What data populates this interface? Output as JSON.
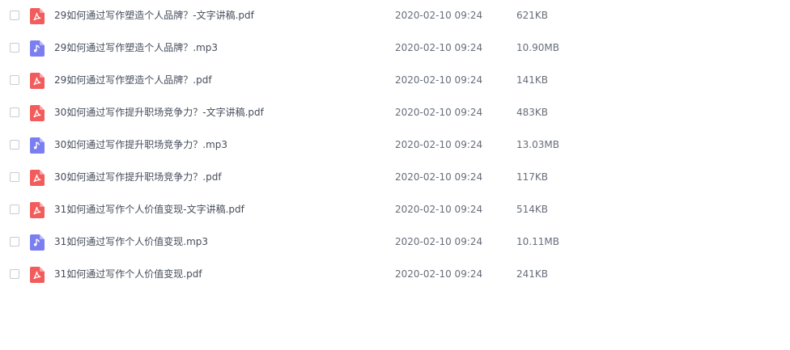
{
  "colors": {
    "pdf_icon": "#f25c5c",
    "mp3_icon": "#7b7ef0"
  },
  "files": [
    {
      "name": "29如何通过写作塑造个人品牌？-文字讲稿.pdf",
      "date": "2020-02-10 09:24",
      "size": "621KB",
      "type": "pdf",
      "icon": "pdf-icon"
    },
    {
      "name": "29如何通过写作塑造个人品牌？.mp3",
      "date": "2020-02-10 09:24",
      "size": "10.90MB",
      "type": "mp3",
      "icon": "music-note-icon"
    },
    {
      "name": "29如何通过写作塑造个人品牌？.pdf",
      "date": "2020-02-10 09:24",
      "size": "141KB",
      "type": "pdf",
      "icon": "pdf-icon"
    },
    {
      "name": "30如何通过写作提升职场竞争力？-文字讲稿.pdf",
      "date": "2020-02-10 09:24",
      "size": "483KB",
      "type": "pdf",
      "icon": "pdf-icon"
    },
    {
      "name": "30如何通过写作提升职场竞争力？.mp3",
      "date": "2020-02-10 09:24",
      "size": "13.03MB",
      "type": "mp3",
      "icon": "music-note-icon"
    },
    {
      "name": "30如何通过写作提升职场竞争力？.pdf",
      "date": "2020-02-10 09:24",
      "size": "117KB",
      "type": "pdf",
      "icon": "pdf-icon"
    },
    {
      "name": "31如何通过写作个人价值变现-文字讲稿.pdf",
      "date": "2020-02-10 09:24",
      "size": "514KB",
      "type": "pdf",
      "icon": "pdf-icon"
    },
    {
      "name": "31如何通过写作个人价值变现.mp3",
      "date": "2020-02-10 09:24",
      "size": "10.11MB",
      "type": "mp3",
      "icon": "music-note-icon"
    },
    {
      "name": "31如何通过写作个人价值变现.pdf",
      "date": "2020-02-10 09:24",
      "size": "241KB",
      "type": "pdf",
      "icon": "pdf-icon"
    }
  ]
}
